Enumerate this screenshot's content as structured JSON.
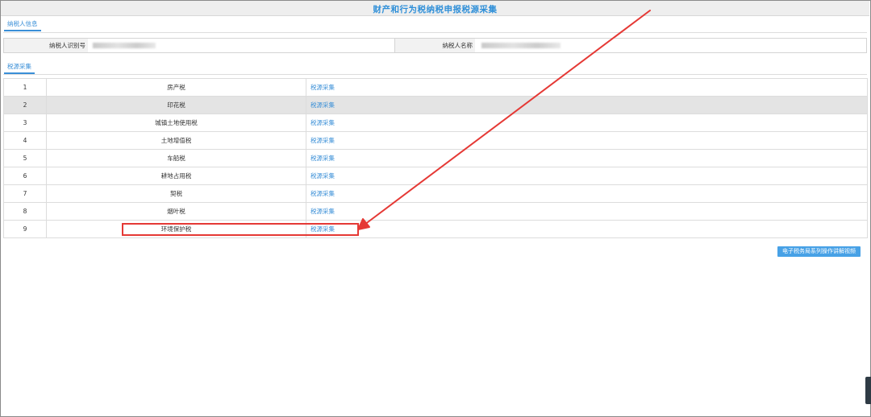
{
  "page": {
    "title": "财产和行为税纳税申报税源采集"
  },
  "taxpayer_section": {
    "tab_label": "纳税人信息",
    "id_label": "纳税人识别号",
    "name_label": "纳税人名称"
  },
  "source_section": {
    "tab_label": "税源采集"
  },
  "table": {
    "rows": [
      {
        "no": "1",
        "name": "房产税",
        "link": "税源采集"
      },
      {
        "no": "2",
        "name": "印花税",
        "link": "税源采集"
      },
      {
        "no": "3",
        "name": "城镇土地使用税",
        "link": "税源采集"
      },
      {
        "no": "4",
        "name": "土地增值税",
        "link": "税源采集"
      },
      {
        "no": "5",
        "name": "车船税",
        "link": "税源采集"
      },
      {
        "no": "6",
        "name": "耕地占用税",
        "link": "税源采集"
      },
      {
        "no": "7",
        "name": "契税",
        "link": "税源采集"
      },
      {
        "no": "8",
        "name": "烟叶税",
        "link": "税源采集"
      },
      {
        "no": "9",
        "name": "环境保护税",
        "link": "税源采集"
      }
    ]
  },
  "video_button": {
    "label": "电子税务局系列操作讲解视频"
  },
  "colors": {
    "accent": "#3a8fd7",
    "title": "#2f8fd8",
    "annotation": "#e53935",
    "row_highlight": "#e4e4e4"
  }
}
